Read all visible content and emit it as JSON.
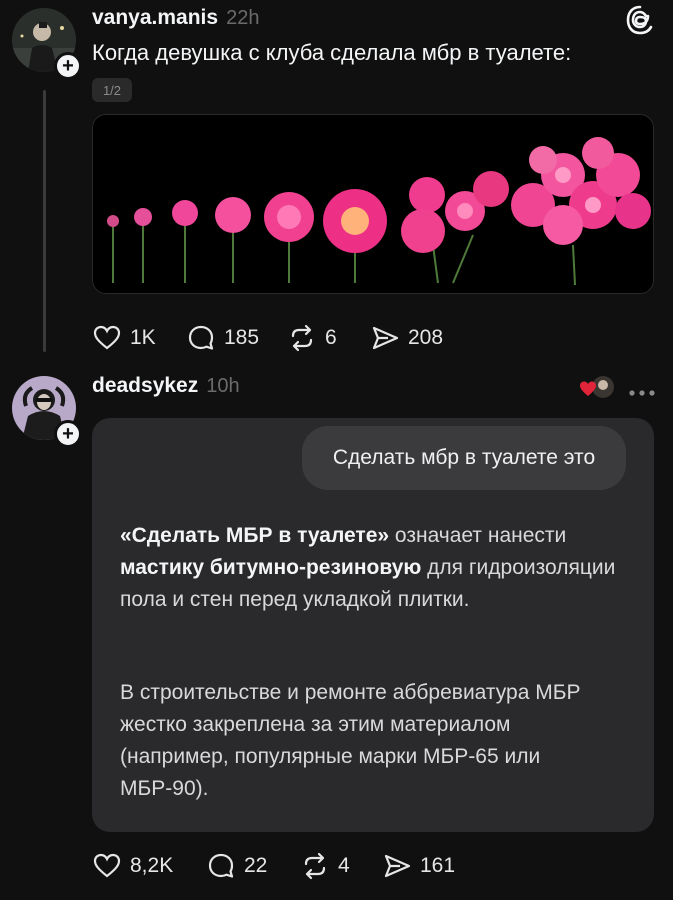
{
  "post": {
    "username": "vanya.manis",
    "time": "22h",
    "text": "Когда девушка с клуба сделала мбр в туалете:",
    "pager": "1/2",
    "likes": "1K",
    "comments": "185",
    "reposts": "6",
    "shares": "208"
  },
  "reply": {
    "username": "deadsykez",
    "time": "10h",
    "query": "Сделать мбр в туалете это",
    "p1_bold1": "«Сделать МБР в туалете»",
    "p1_t1": " означает нанести ",
    "p1_bold2": "мастику битумно-резиновую",
    "p1_t2": " для гидроизоляции пола и стен перед укладкой плитки.",
    "p2": "В строительстве и ремонте аббревиатура МБР жестко закреплена за этим материалом (например, популярные марки МБР-65 или МБР-90).",
    "likes": "8,2K",
    "comments": "22",
    "reposts": "4",
    "shares": "161"
  },
  "icons": [
    "threads-logo-icon",
    "heart-icon",
    "comment-icon",
    "repost-icon",
    "share-icon",
    "more-icon"
  ],
  "colors": {
    "background": "#101010",
    "card": "#2a2a2d",
    "bubble": "#3b3b3e",
    "muted": "#6b6b6b",
    "heart": "#e0243a"
  }
}
